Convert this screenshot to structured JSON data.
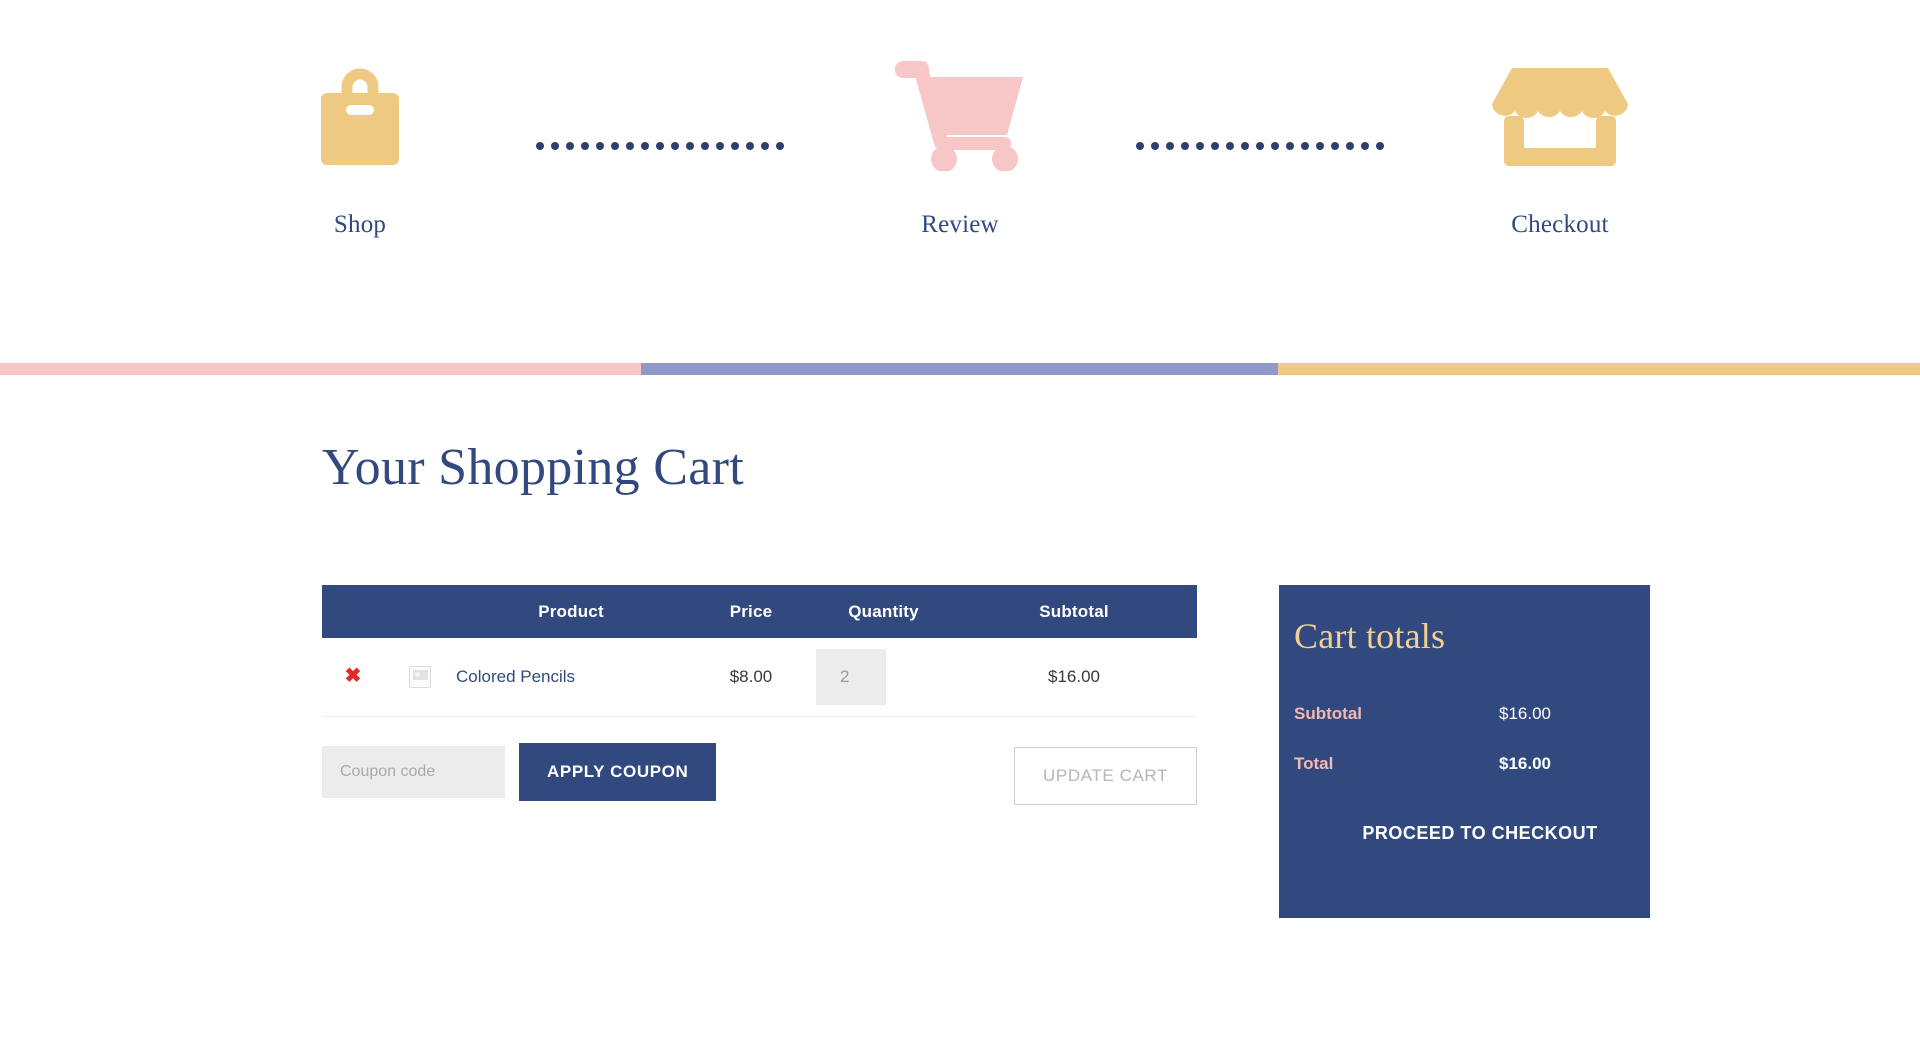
{
  "steps": [
    {
      "label": "Shop",
      "icon": "shopping-bag-icon",
      "color": "#eec981"
    },
    {
      "label": "Review",
      "icon": "shopping-cart-icon",
      "color": "#f7c6c6"
    },
    {
      "label": "Checkout",
      "icon": "storefront-icon",
      "color": "#eec981"
    }
  ],
  "connector": {
    "icon": "dotted-connector",
    "dot_color": "#2e3f6e",
    "dot_count": 17
  },
  "progress_bar": {
    "segments": [
      {
        "name": "shop-segment",
        "color": "#f7c6c6"
      },
      {
        "name": "review-segment",
        "color": "#9099c9"
      },
      {
        "name": "checkout-segment",
        "color": "#eec981"
      }
    ]
  },
  "page": {
    "title": "Your Shopping Cart"
  },
  "cart_table": {
    "headers": [
      "",
      "",
      "Product",
      "Price",
      "Quantity",
      "Subtotal"
    ],
    "rows": [
      {
        "remove_label": "✖",
        "thumbnail": "image-placeholder-icon",
        "product": "Colored Pencils",
        "price": "$8.00",
        "quantity": "2",
        "subtotal": "$16.00"
      }
    ]
  },
  "actions": {
    "coupon_placeholder": "Coupon code",
    "coupon_value": "",
    "apply_label": "APPLY COUPON",
    "update_label": "UPDATE CART"
  },
  "totals": {
    "title": "Cart totals",
    "rows": [
      {
        "label": "Subtotal",
        "value": "$16.00"
      },
      {
        "label": "Total",
        "value": "$16.00"
      }
    ],
    "checkout_label": "PROCEED TO CHECKOUT"
  },
  "colors": {
    "navy": "#31497e",
    "gold": "#eec981",
    "pink": "#f7c6c6",
    "periwinkle": "#9099c9",
    "totals_title": "#f3d08e",
    "totals_label": "#f5b9b2",
    "remove_red": "#e02b27"
  }
}
